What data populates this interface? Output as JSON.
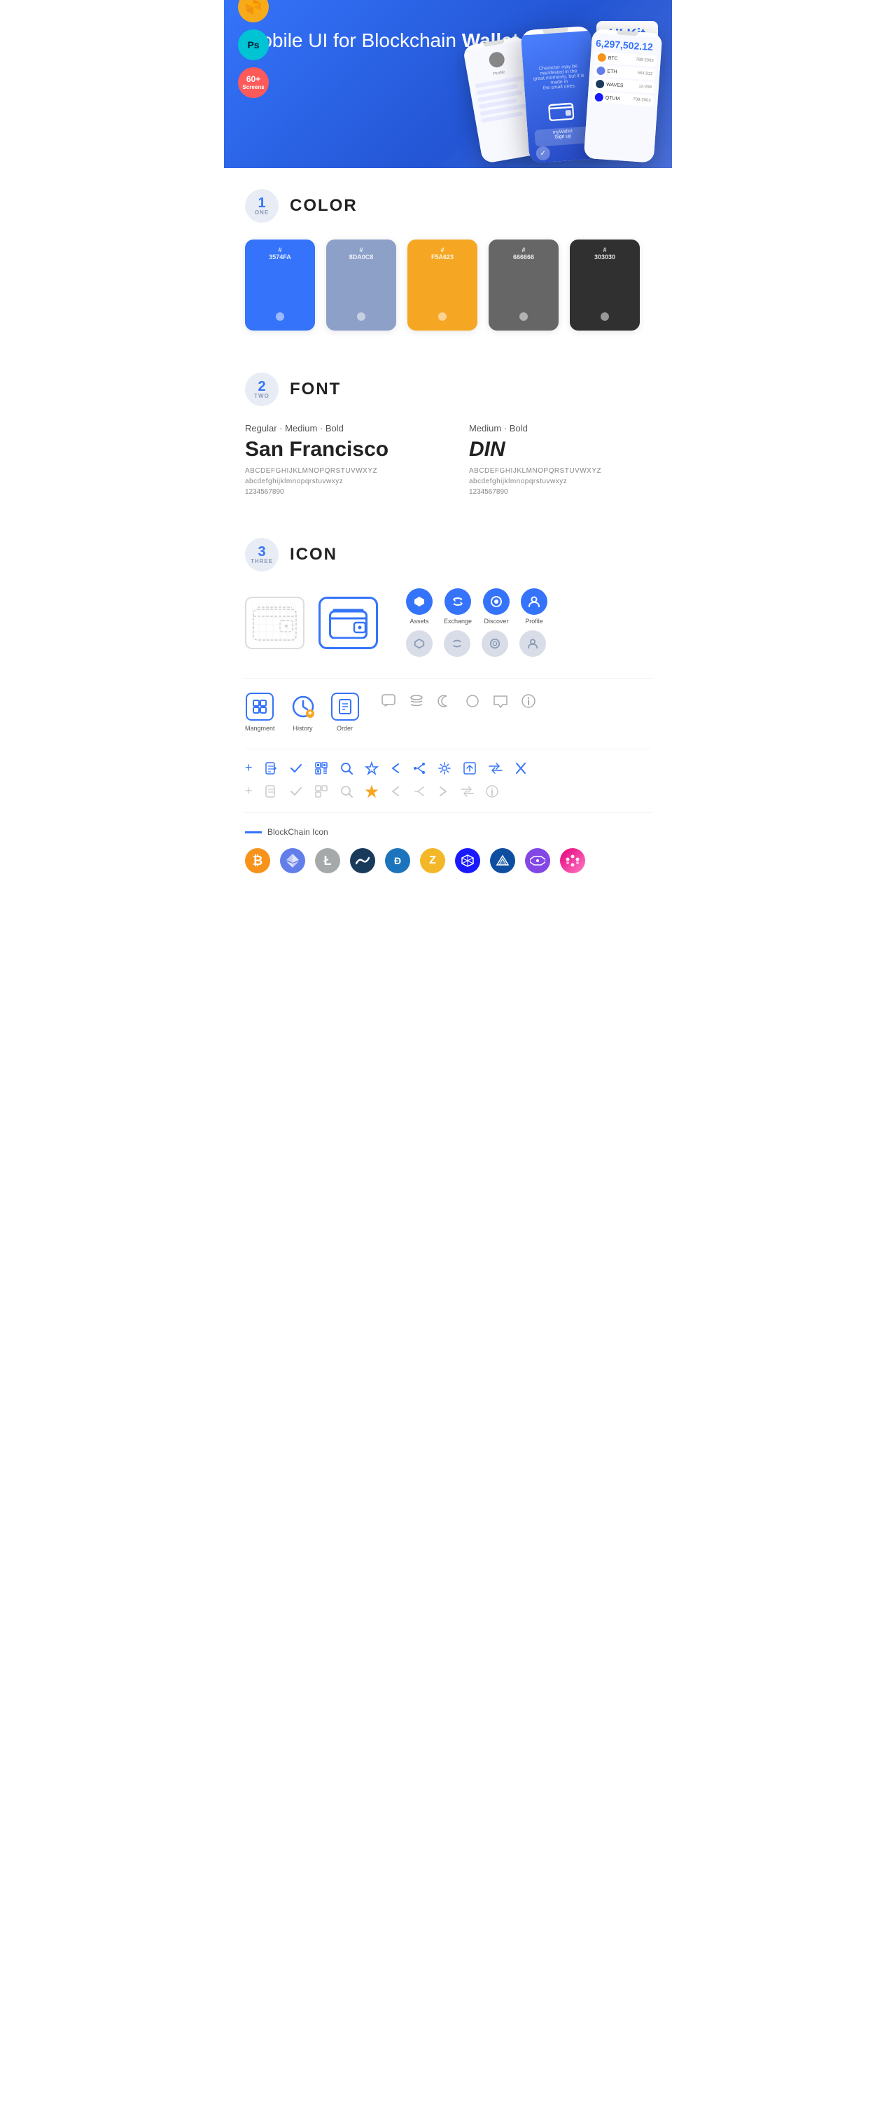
{
  "hero": {
    "title": "Mobile UI for Blockchain ",
    "title_bold": "Wallet",
    "badge": "UI Kit",
    "sketch_label": "Sk",
    "ps_label": "Ps",
    "screens_label": "60+\nScreens"
  },
  "sections": {
    "color": {
      "number": "1",
      "sub": "ONE",
      "title": "COLOR",
      "colors": [
        {
          "hex": "#3574FA",
          "label": "#\n3574FA"
        },
        {
          "hex": "#8DA0C8",
          "label": "#\n8DA0C8"
        },
        {
          "hex": "#F5A623",
          "label": "#\nF5A623"
        },
        {
          "hex": "#666666",
          "label": "#\n666666"
        },
        {
          "hex": "#303030",
          "label": "#\n303030"
        }
      ]
    },
    "font": {
      "number": "2",
      "sub": "TWO",
      "title": "FONT",
      "fonts": [
        {
          "styles": "Regular · Medium · Bold",
          "name": "San Francisco",
          "uppercase": "ABCDEFGHIJKLMNOPQRSTUVWXYZ",
          "lowercase": "abcdefghijklmnopqrstuvwxyz",
          "numbers": "1234567890"
        },
        {
          "styles": "Medium · Bold",
          "name": "DIN",
          "uppercase": "ABCDEFGHIJKLMNOPQRSTUVWXYZ",
          "lowercase": "abcdefghijklmnopqrstuvwxyz",
          "numbers": "1234567890"
        }
      ]
    },
    "icon": {
      "number": "3",
      "sub": "THREE",
      "title": "ICON",
      "nav_icons": [
        {
          "label": "Assets",
          "symbol": "◆"
        },
        {
          "label": "Exchange",
          "symbol": "♊"
        },
        {
          "label": "Discover",
          "symbol": "⊙"
        },
        {
          "label": "Profile",
          "symbol": "👤"
        }
      ],
      "bottom_icons": [
        {
          "label": "Mangment",
          "symbol": "⊞"
        },
        {
          "label": "History",
          "symbol": "🕐"
        },
        {
          "label": "Order",
          "symbol": "📋"
        }
      ],
      "tool_icons": [
        "+",
        "⊟",
        "✓",
        "⊞",
        "🔍",
        "☆",
        "<",
        "<",
        "⚙",
        "⊡",
        "⇄",
        "×"
      ],
      "blockchain_label": "BlockChain Icon",
      "crypto_icons": [
        {
          "symbol": "₿",
          "bg": "#F7931A",
          "name": "bitcoin"
        },
        {
          "symbol": "Ξ",
          "bg": "#627EEA",
          "name": "ethereum"
        },
        {
          "symbol": "Ł",
          "bg": "#A6A9AA",
          "name": "litecoin"
        },
        {
          "symbol": "◈",
          "bg": "#1A3A5C",
          "name": "waves"
        },
        {
          "symbol": "Đ",
          "bg": "#1C75BC",
          "name": "dash"
        },
        {
          "symbol": "ℤ",
          "bg": "#F4B728",
          "name": "zcash"
        },
        {
          "symbol": "⬡",
          "bg": "#1A1AFF",
          "name": "grid"
        },
        {
          "symbol": "△",
          "bg": "#0D4EA0",
          "name": "lisk"
        },
        {
          "symbol": "⬡",
          "bg": "#8247E5",
          "name": "matic"
        },
        {
          "symbol": "●",
          "bg": "linear-gradient(135deg,#ff6b6b,#ff9f9f)",
          "name": "dot"
        }
      ]
    }
  }
}
